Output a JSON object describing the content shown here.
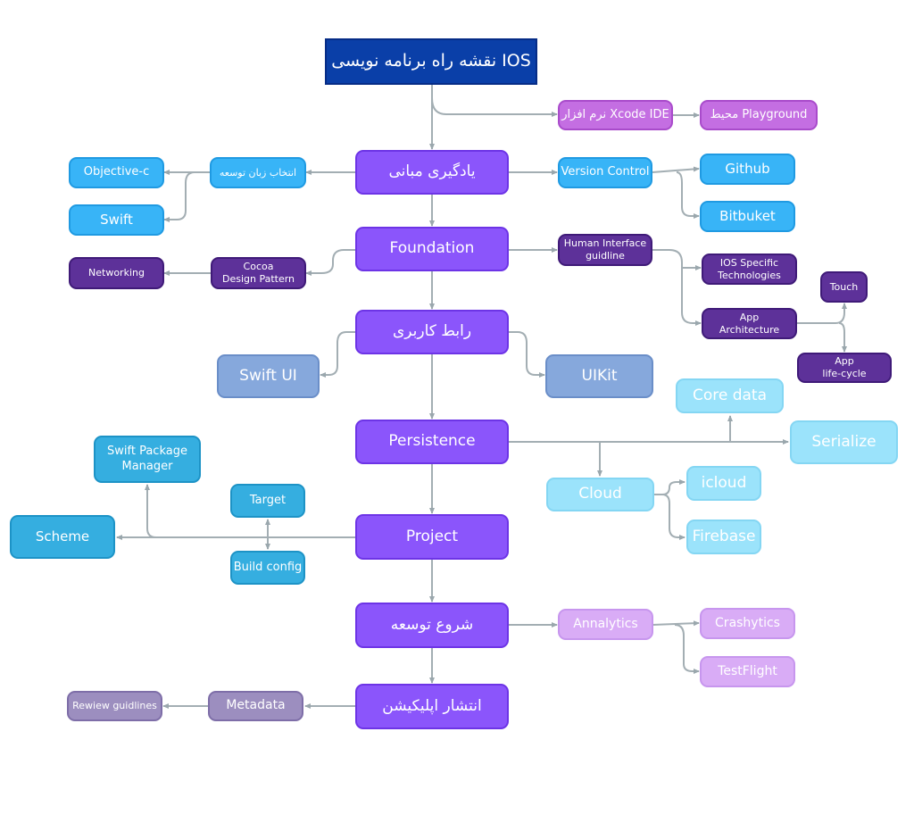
{
  "diagram": {
    "title": "نقشه راه برنامه نویسی IOS",
    "colors": {
      "title": "#0a3fa8",
      "main": "#8b55fb",
      "tool": "#c46ee2",
      "basics": "#38b4f7",
      "foundation_sub": "#5d3199",
      "ui_sub": "#86a8dc",
      "persistence_sub": "#9be3fb",
      "project_sub": "#35aee0",
      "dev_sub": "#d9acf6",
      "publish_sub": "#9c8ebf",
      "connector": "#9aa7ad"
    },
    "main_nodes": {
      "basics": "یادگیری مبانی",
      "foundation": "Foundation",
      "ui": "رابط کاربری",
      "persistence": "Persistence",
      "project": "Project",
      "start_dev": "شروع توسعه",
      "publish": "انتشار اپلیکیشن"
    },
    "tools": {
      "xcode": "نرم افزار Xcode IDE",
      "playground": "محیط Playground"
    },
    "basics_branch": {
      "choose_language": "انتخاب زبان توسعه",
      "objective_c": "Objective-c",
      "swift": "Swift",
      "version_control": "Version Control",
      "github": "Github",
      "bitbucket": "Bitbuket"
    },
    "foundation_branch": {
      "cocoa": "Cocoa\nDesign Pattern",
      "networking": "Networking",
      "hig": "Human Interface\nguidline",
      "ios_tech": "IOS Specific\nTechnologies",
      "app_arch": "App\nArchitecture",
      "touch": "Touch",
      "lifecycle": "App\nlife-cycle"
    },
    "ui_branch": {
      "swiftui": "Swift UI",
      "uikit": "UIKit"
    },
    "persistence_branch": {
      "core_data": "Core data",
      "serialize": "Serialize",
      "cloud": "Cloud",
      "icloud": "icloud",
      "firebase": "Firebase"
    },
    "project_branch": {
      "spm": "Swift Package\nManager",
      "scheme": "Scheme",
      "target": "Target",
      "build_config": "Build config"
    },
    "dev_branch": {
      "analytics": "Annalytics",
      "crashytics": "Crashytics",
      "testflight": "TestFlight"
    },
    "publish_branch": {
      "metadata": "Metadata",
      "review": "Rewiew guidlines"
    }
  }
}
